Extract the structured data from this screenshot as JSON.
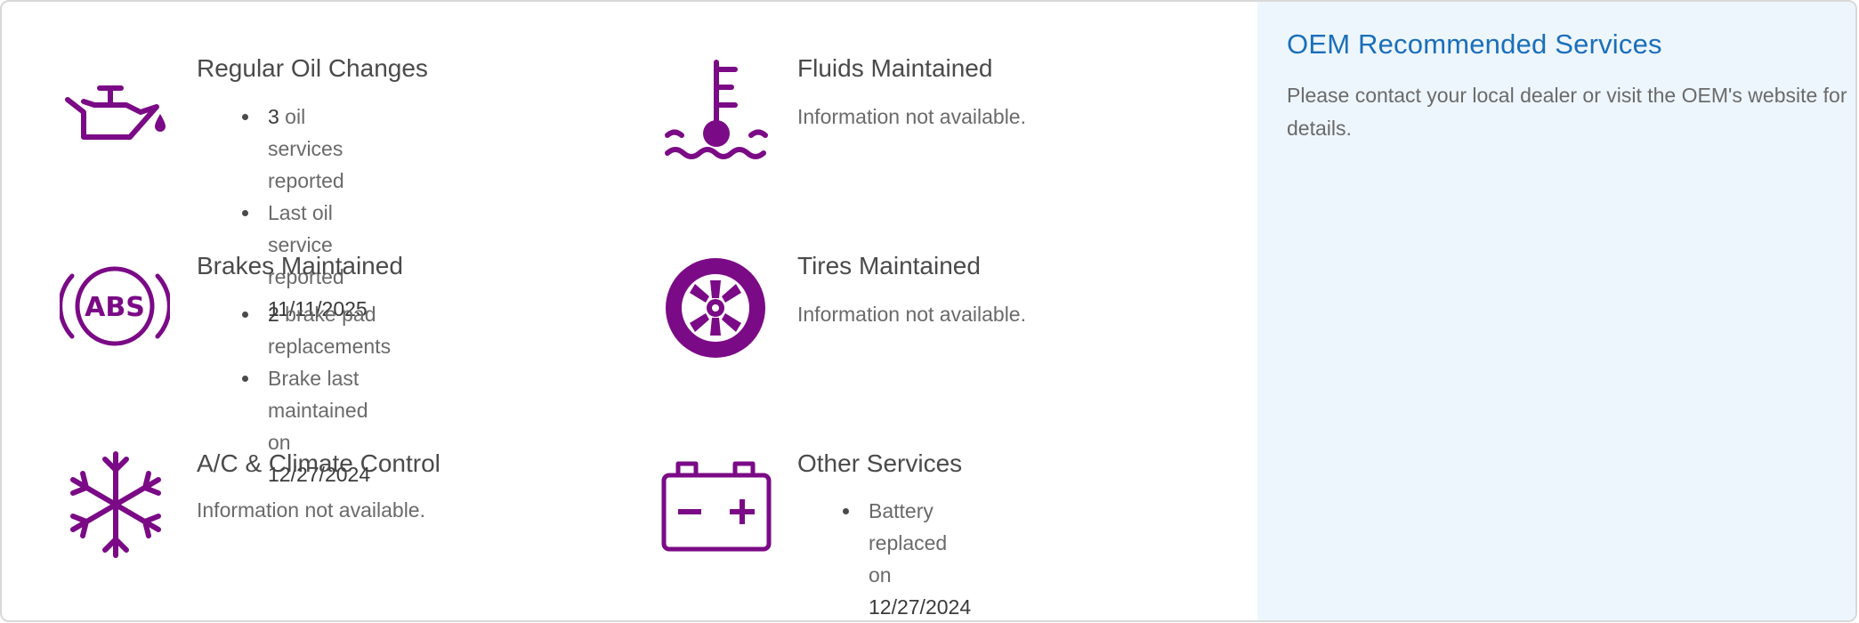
{
  "colors": {
    "icon_purple": "#7b0a86",
    "oem_blue": "#1a6fba",
    "right_panel_bg": "#eef6fd"
  },
  "services": {
    "oil": {
      "icon": "oil-can-icon",
      "title": "Regular Oil Changes",
      "bullets": [
        {
          "count": "3",
          "text": " oil services reported"
        },
        {
          "text": "Last oil service reported",
          "date": "11/11/2025"
        }
      ]
    },
    "fluids": {
      "icon": "coolant-temperature-icon",
      "title": "Fluids Maintained",
      "text": "Information not available."
    },
    "brakes": {
      "icon": "abs-icon",
      "title": "Brakes Maintained",
      "bullets": [
        {
          "count": "2",
          "text": " brake pad replacements"
        },
        {
          "text": "Brake last maintained on",
          "date": "12/27/2024"
        }
      ]
    },
    "tires": {
      "icon": "tire-icon",
      "title": "Tires Maintained",
      "text": "Information not available."
    },
    "ac": {
      "icon": "snowflake-icon",
      "title": "A/C & Climate Control",
      "text": "Information not available."
    },
    "other": {
      "icon": "battery-icon",
      "title": "Other Services",
      "bullets": [
        {
          "text": "Battery replaced on",
          "date": "12/27/2024"
        }
      ]
    }
  },
  "oem": {
    "title": "OEM Recommended Services",
    "text": "Please contact your local dealer or visit the OEM's website for details."
  }
}
